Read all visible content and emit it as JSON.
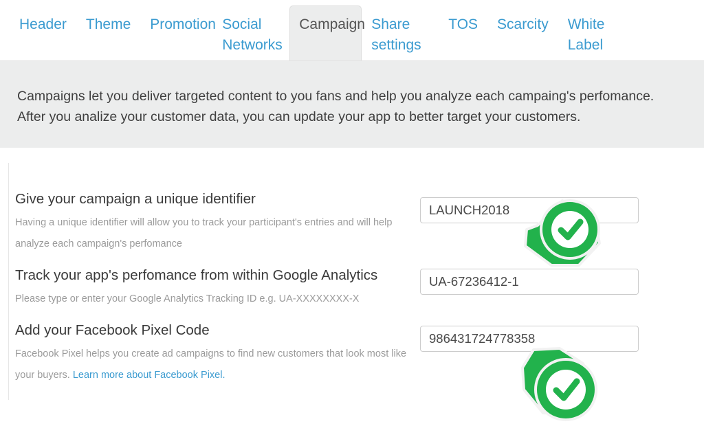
{
  "tabs": [
    {
      "label": "Header",
      "active": false
    },
    {
      "label": "Theme",
      "active": false
    },
    {
      "label": "Promotion",
      "active": false
    },
    {
      "label": "Social Networks",
      "active": false
    },
    {
      "label": "Campaign",
      "active": true
    },
    {
      "label": "Share settings",
      "active": false
    },
    {
      "label": "TOS",
      "active": false
    },
    {
      "label": "Scarcity",
      "active": false
    },
    {
      "label": "White Label",
      "active": false
    }
  ],
  "banner": {
    "text": "Campaigns let you deliver targeted content to you fans and help you analyze each campaing's perfomance. After you analize your customer data, you can update your app to better target your customers."
  },
  "fields": [
    {
      "label": "Give your campaign a unique identifier",
      "help": "Having a unique identifier will allow you to track your participant's entries and will help analyze each campaign's perfomance",
      "value": "LAUNCH2018",
      "placeholder": ""
    },
    {
      "label": "Track your app's perfomance from within Google Analytics",
      "help": "Please type or enter your Google Analytics Tracking ID e.g. UA-XXXXXXXX-X",
      "value": "UA-67236412-1",
      "placeholder": ""
    },
    {
      "label": "Add your Facebook Pixel Code",
      "help_before": "Facebook Pixel helps you create ad campaigns to find new customers that look most like your buyers. ",
      "help_link": "Learn more about Facebook Pixel.",
      "value": "986431724778358",
      "placeholder": ""
    }
  ],
  "markers": [
    {
      "name": "check-marker-identifier",
      "icon": "check-circle-pin-icon",
      "tail": "bottom-left"
    },
    {
      "name": "check-marker-facebook-pixel",
      "icon": "check-circle-pin-icon",
      "tail": "top-left"
    }
  ],
  "colors": {
    "link": "#3b9bd0",
    "accent_green": "#22b24c",
    "banner_bg": "#eceded",
    "active_tab_bg": "#eceded",
    "border": "#cccccc"
  }
}
